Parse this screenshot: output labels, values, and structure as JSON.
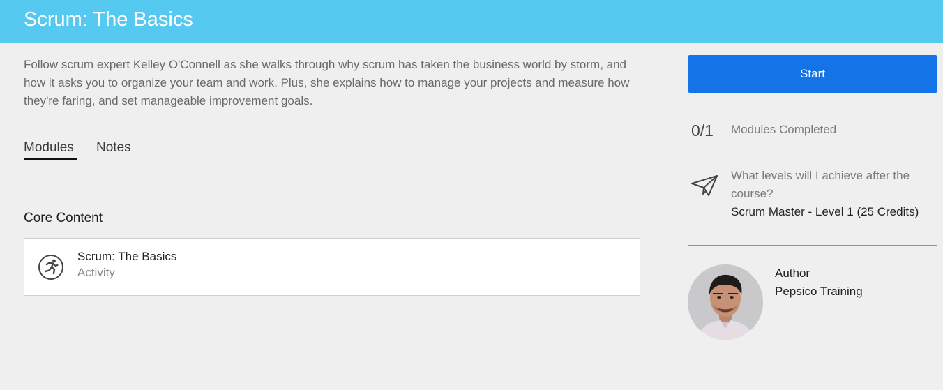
{
  "header": {
    "title": "Scrum: The Basics",
    "background_color": "#56c9f1"
  },
  "course": {
    "description": "Follow scrum expert Kelley O'Connell as she walks through why scrum has taken the business world by storm, and how it asks you to organize your team and work. Plus, she explains how to manage your projects and measure how they're faring, and set manageable improvement goals."
  },
  "tabs": [
    {
      "label": "Modules",
      "active": true
    },
    {
      "label": "Notes",
      "active": false
    }
  ],
  "core_content": {
    "heading": "Core Content",
    "modules": [
      {
        "title": "Scrum: The Basics",
        "type": "Activity",
        "icon": "running-person-icon"
      }
    ]
  },
  "sidebar": {
    "start_label": "Start",
    "start_color": "#1473e6",
    "progress": {
      "count": "0/1",
      "label": "Modules Completed"
    },
    "levels": {
      "icon": "paper-plane-icon",
      "question": "What levels will I achieve after the course?",
      "value": "Scrum Master - Level 1 (25 Credits)"
    },
    "author": {
      "label": "Author",
      "name": "Pepsico Training"
    }
  }
}
